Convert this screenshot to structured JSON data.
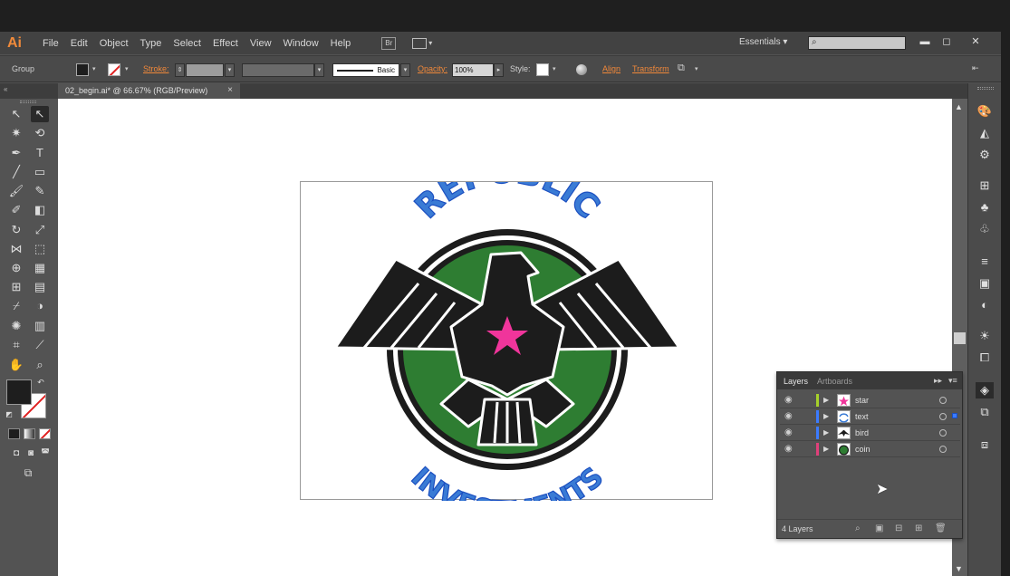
{
  "app": {
    "logo": "Ai"
  },
  "menu": [
    "File",
    "Edit",
    "Object",
    "Type",
    "Select",
    "Effect",
    "View",
    "Window",
    "Help"
  ],
  "menubar": {
    "bridge_label": "Br",
    "workspace": "Essentials",
    "workspace_caret": "▾",
    "window_buttons": [
      "▬",
      "◻",
      "✕"
    ]
  },
  "control": {
    "selection": "Group",
    "stroke_label": "Stroke:",
    "brush": "Basic",
    "opacity_label": "Opacity:",
    "opacity_value": "100%",
    "style_label": "Style:",
    "align": "Align",
    "transform": "Transform"
  },
  "document": {
    "tab_title": "02_begin.ai* @ 66.67% (RGB/Preview)",
    "close": "×"
  },
  "artwork": {
    "top_text": "REPUBLIC",
    "bottom_text": "INVESTMENTS",
    "colors": {
      "coin": "#2e7d32",
      "ring": "#1c1c1c",
      "star": "#f0359b",
      "text": "#3a7bd5",
      "bird": "#1c1c1c"
    }
  },
  "layers_panel": {
    "tabs": [
      "Layers",
      "Artboards"
    ],
    "layers": [
      {
        "name": "star",
        "color": "#a6d12a",
        "thumb": "star-thumb"
      },
      {
        "name": "text",
        "color": "#3b7bff",
        "thumb": "text-thumb",
        "selected": true
      },
      {
        "name": "bird",
        "color": "#3b7bff",
        "thumb": "bird-thumb"
      },
      {
        "name": "coin",
        "color": "#e0407a",
        "thumb": "coin-thumb"
      }
    ],
    "count": "4 Layers"
  }
}
